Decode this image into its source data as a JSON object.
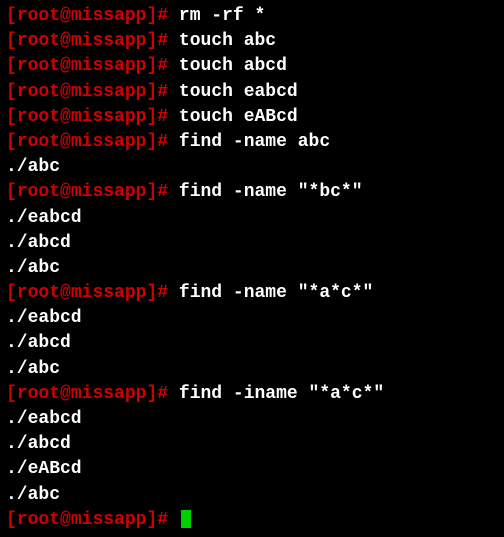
{
  "prompt": {
    "open": "[",
    "user": "root",
    "at": "@",
    "host": "missapp",
    "close": "]",
    "symbol": "# "
  },
  "lines": [
    {
      "type": "cmd",
      "text": "rm -rf *"
    },
    {
      "type": "cmd",
      "text": "touch abc"
    },
    {
      "type": "cmd",
      "text": "touch abcd"
    },
    {
      "type": "cmd",
      "text": "touch eabcd"
    },
    {
      "type": "cmd",
      "text": "touch eABcd"
    },
    {
      "type": "cmd",
      "text": "find -name abc"
    },
    {
      "type": "out",
      "text": "./abc"
    },
    {
      "type": "cmd",
      "text": "find -name \"*bc*\""
    },
    {
      "type": "out",
      "text": "./eabcd"
    },
    {
      "type": "out",
      "text": "./abcd"
    },
    {
      "type": "out",
      "text": "./abc"
    },
    {
      "type": "cmd",
      "text": "find -name \"*a*c*\""
    },
    {
      "type": "out",
      "text": "./eabcd"
    },
    {
      "type": "out",
      "text": "./abcd"
    },
    {
      "type": "out",
      "text": "./abc"
    },
    {
      "type": "cmd",
      "text": "find -iname \"*a*c*\""
    },
    {
      "type": "out",
      "text": "./eabcd"
    },
    {
      "type": "out",
      "text": "./abcd"
    },
    {
      "type": "out",
      "text": "./eABcd"
    },
    {
      "type": "out",
      "text": "./abc"
    },
    {
      "type": "cursor"
    }
  ]
}
